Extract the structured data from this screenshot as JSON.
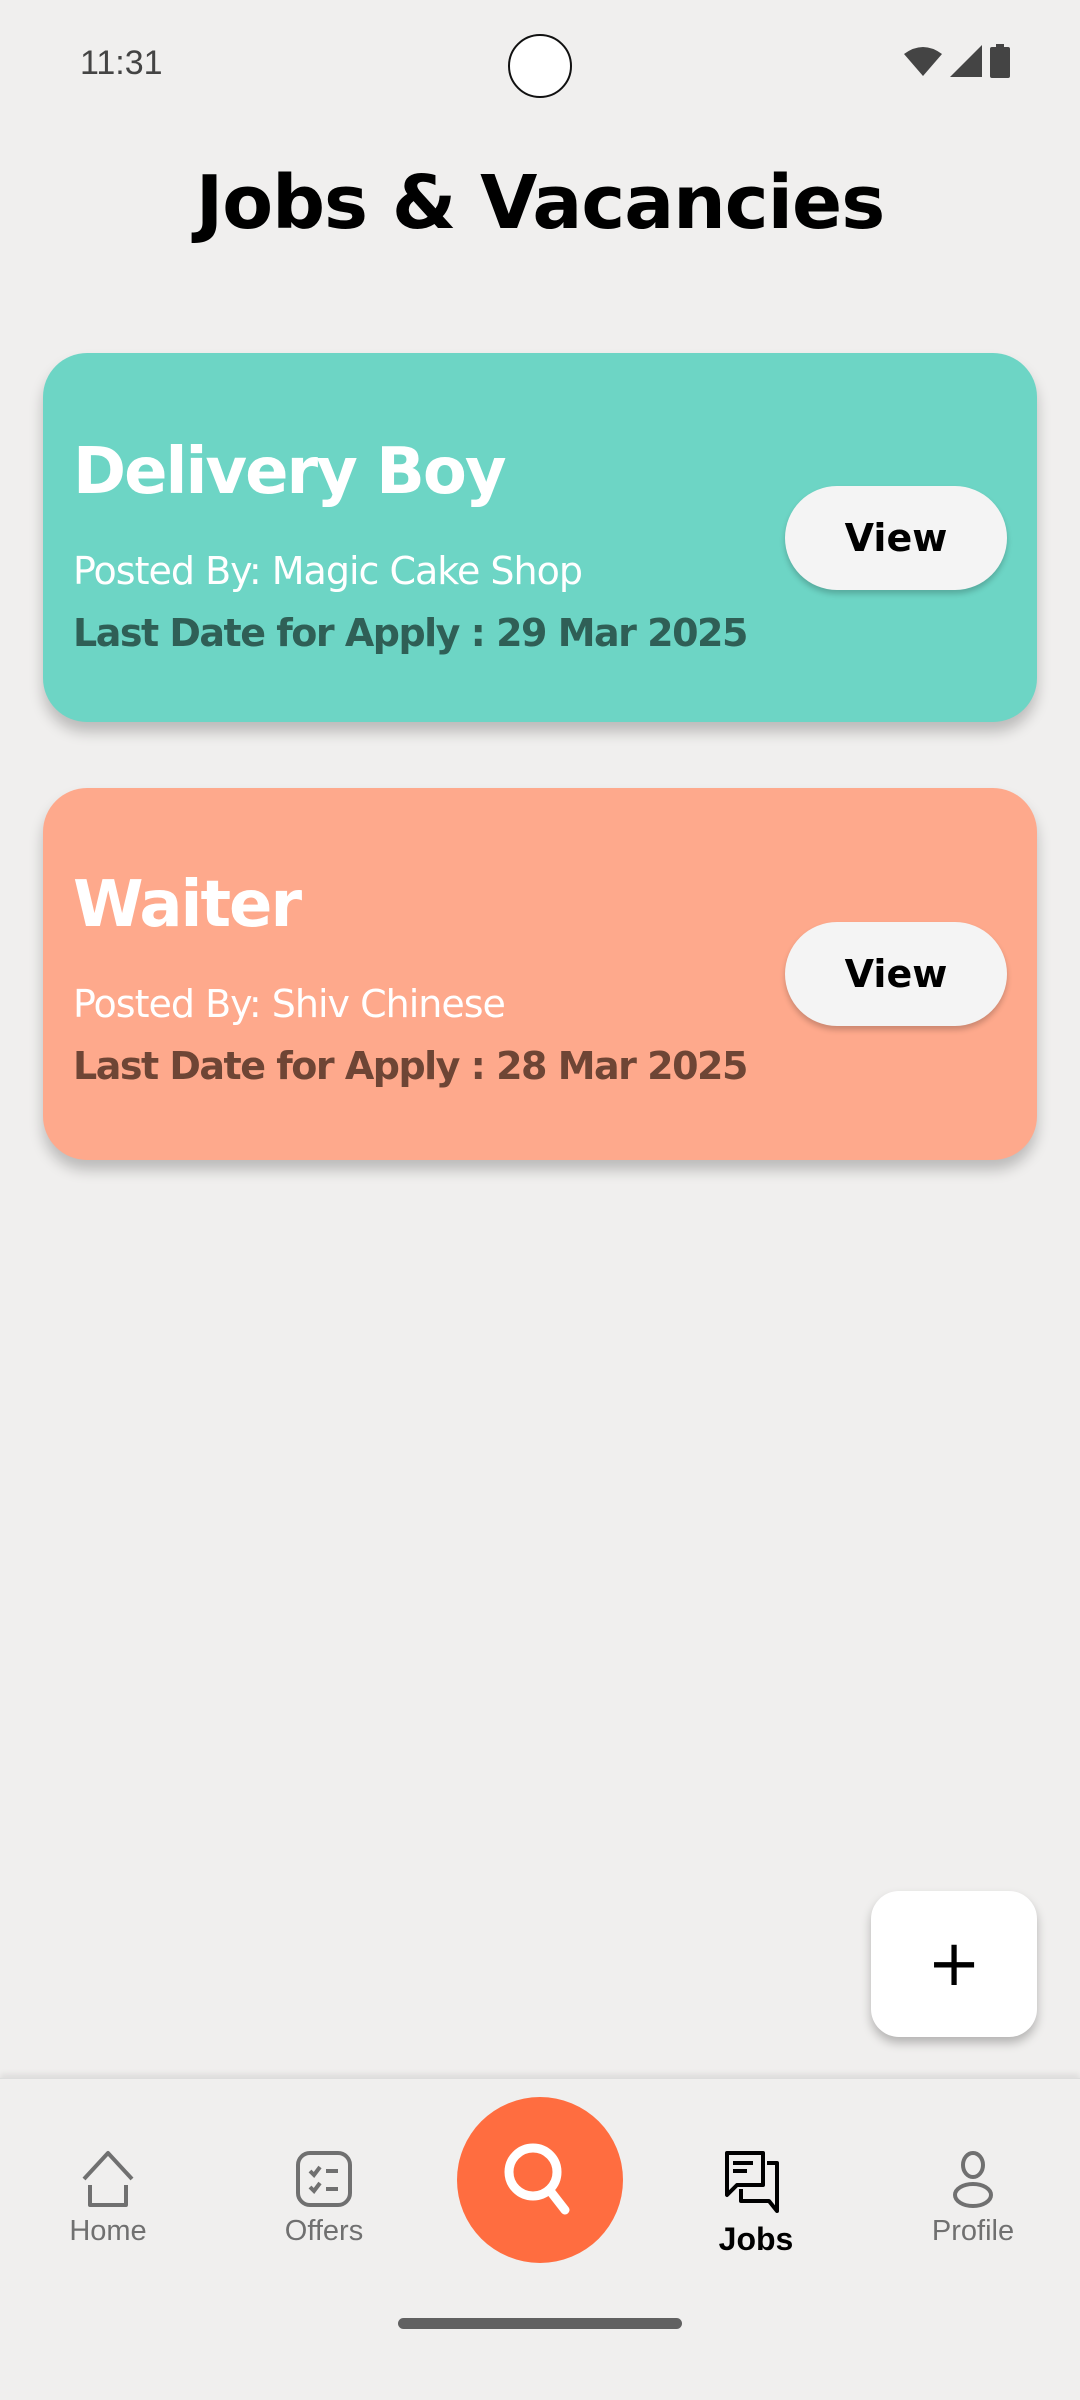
{
  "status_bar": {
    "time": "11:31"
  },
  "header": {
    "title": "Jobs & Vacancies"
  },
  "jobs": [
    {
      "title": "Delivery Boy",
      "posted_by": "Posted By: Magic Cake Shop",
      "last_date": "Last Date for Apply : 29 Mar 2025",
      "button": "View",
      "color": "#6dd5c5"
    },
    {
      "title": "Waiter",
      "posted_by": "Posted By: Shiv Chinese",
      "last_date": "Last Date for Apply : 28 Mar 2025",
      "button": "View",
      "color": "#fea98c"
    }
  ],
  "fab": {
    "label": "+"
  },
  "nav": {
    "home": "Home",
    "offers": "Offers",
    "jobs": "Jobs",
    "profile": "Profile",
    "active": "Jobs"
  }
}
